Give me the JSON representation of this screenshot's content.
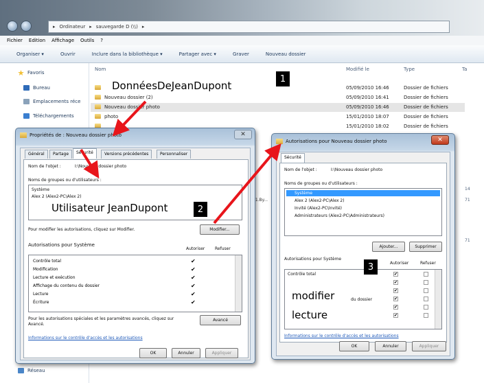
{
  "explorer": {
    "breadcrumb": [
      "Ordinateur",
      "sauvegarde D (\\\\)"
    ],
    "menu": [
      "Fichier",
      "Edition",
      "Affichage",
      "Outils",
      "?"
    ],
    "toolbar": [
      "Organiser ▾",
      "Ouvrir",
      "Inclure dans la bibliothèque ▾",
      "Partager avec ▾",
      "Graver",
      "Nouveau dossier"
    ],
    "nav": {
      "favoris": "Favoris",
      "bureau": "Bureau",
      "emplacements": "Emplacements réce",
      "telechargements": "Téléchargements",
      "reseau": "Réseau"
    },
    "columns": {
      "nom": "Nom",
      "modifie": "Modifié le",
      "type": "Type",
      "taille": "Ta"
    },
    "files": [
      {
        "name": "",
        "date": "05/09/2010 16:46",
        "type": "Dossier de fichiers"
      },
      {
        "name": "Nouveau dossier (2)",
        "date": "05/09/2010 16:41",
        "type": "Dossier de fichiers"
      },
      {
        "name": "Nouveau dossier photo",
        "date": "05/09/2010 16:46",
        "type": "Dossier de fichiers"
      },
      {
        "name": "photo",
        "date": "15/01/2010 18:07",
        "type": "Dossier de fichiers"
      },
      {
        "name": "",
        "date": "15/01/2010 18:02",
        "type": "Dossier de fichiers"
      }
    ],
    "side_values": [
      "14",
      "71",
      "71"
    ],
    "partial_text": "21.By..."
  },
  "dialog1": {
    "title": "Propriétés de : Nouveau dossier photo",
    "tabs": [
      "Général",
      "Partage",
      "Sécurité",
      "Versions précédentes",
      "Personnaliser"
    ],
    "object_label": "Nom de l'objet :",
    "object_value": "I:\\Nouveau dossier photo",
    "groups_label": "Noms de groupes ou d'utilisateurs :",
    "users": [
      "Système",
      "Alex 2 (Alex2-PC\\Alex 2)"
    ],
    "modify_hint": "Pour modifier les autorisations, cliquez sur Modifier.",
    "modify_button": "Modifier...",
    "perms_title": "Autorisations pour Système",
    "allow": "Autoriser",
    "deny": "Refuser",
    "perms": [
      "Contrôle total",
      "Modification",
      "Lecture et exécution",
      "Affichage du contenu du dossier",
      "Lecture",
      "Écriture"
    ],
    "special_hint_1": "Pour les autorisations spéciales et les paramètres avancés, cliquez sur",
    "special_hint_2": "Avancé.",
    "advanced_button": "Avancé",
    "link": "Informations sur le contrôle d'accès et les autorisations",
    "ok": "OK",
    "cancel": "Annuler",
    "apply": "Appliquer"
  },
  "dialog2": {
    "title": "Autorisations pour Nouveau dossier photo",
    "tab": "Sécurité",
    "object_label": "Nom de l'objet :",
    "object_value": "I:\\Nouveau dossier photo",
    "groups_label": "Noms de groupes ou d'utilisateurs :",
    "users": [
      "Système",
      "Alex 2 (Alex2-PC\\Alex 2)",
      "Invité (Alex2-PC\\Invité)",
      "Administrateurs (Alex2-PC\\Administrateurs)"
    ],
    "add_button": "Ajouter...",
    "remove_button": "Supprimer",
    "perms_title": "Autorisations pour Système",
    "allow": "Autoriser",
    "deny": "Refuser",
    "perm_first": "Contrôle total",
    "perm_partial": "du dossier",
    "link": "Informations sur le contrôle d'accès et les autorisations",
    "ok": "OK",
    "cancel": "Annuler",
    "apply": "Appliquer"
  },
  "annotations": {
    "folder_name": "DonnéesDeJeanDupont",
    "user_name": "Utilisateur JeanDupont",
    "modifier": "modifier",
    "lecture": "lecture",
    "badge1": "1",
    "badge2": "2",
    "badge3": "3"
  },
  "colors": {
    "arrow": "#e8151b",
    "link": "#1a56b8",
    "selection": "#3399ff"
  }
}
